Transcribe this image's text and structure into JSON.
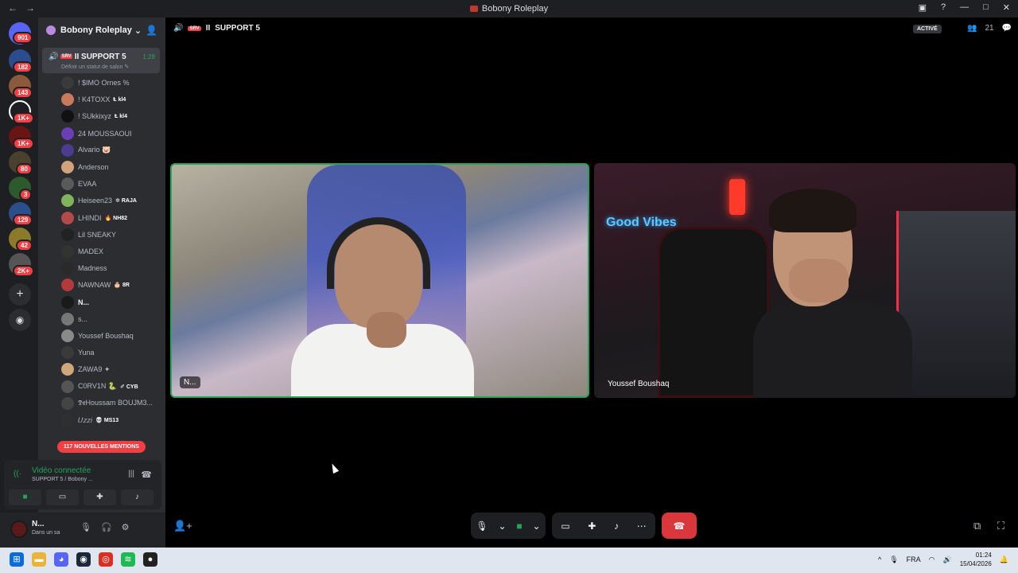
{
  "window": {
    "title": "Bobony Roleplay",
    "back": "←",
    "forward": "→"
  },
  "servers": [
    {
      "badge": "901"
    },
    {
      "badge": "182"
    },
    {
      "badge": "143"
    },
    {
      "badge": "1K+"
    },
    {
      "badge": "1K+"
    },
    {
      "badge": "80"
    },
    {
      "badge": "3"
    },
    {
      "badge": "129"
    },
    {
      "badge": "42"
    },
    {
      "badge": "2K+"
    }
  ],
  "guild": {
    "name": "Bobony Roleplay",
    "caret": "⌄"
  },
  "voice_channel": {
    "name": "SUPPORT 5",
    "prefix": "II",
    "tag": "SRV",
    "timer": "1:28",
    "status_placeholder": "Définir un statut de salon ✎"
  },
  "members": [
    {
      "name": "! $IMO Ornes %",
      "tag": "",
      "color": "#3a3a3a"
    },
    {
      "name": "! K4TOXX",
      "tag": "Ⱡ kl4",
      "color": "#c97a5d"
    },
    {
      "name": "! SUkkixyz",
      "tag": "Ⱡ kl4",
      "color": "#111111"
    },
    {
      "name": "24 MOUSSAOUI",
      "tag": "",
      "color": "#6a3fb4"
    },
    {
      "name": "Alvario 🐷",
      "tag": "",
      "color": "#4b3c8f"
    },
    {
      "name": "Anderson",
      "tag": "",
      "color": "#d1a37a"
    },
    {
      "name": "EVAA",
      "tag": "",
      "color": "#5a5a5a"
    },
    {
      "name": "Heiseen23",
      "tag": "✲ RAJA",
      "color": "#7fb35c"
    },
    {
      "name": "LHINDI",
      "tag": "🔥 NH82",
      "color": "#b34a4a"
    },
    {
      "name": "Lil SNEAKY",
      "tag": "",
      "color": "#222222"
    },
    {
      "name": "MADEX",
      "tag": "",
      "color": "#333333"
    },
    {
      "name": "Madness",
      "tag": "",
      "color": "#2a2a2a"
    },
    {
      "name": "NAWNAW",
      "tag": "🎂 8R",
      "color": "#b33a3a"
    },
    {
      "name": "N...",
      "tag": "",
      "color": "#1a1a1a"
    },
    {
      "name": "s...",
      "tag": "",
      "color": "#777777"
    },
    {
      "name": "Youssef Boushaq",
      "tag": "",
      "color": "#8a8a8a"
    },
    {
      "name": "Yuna",
      "tag": "",
      "color": "#3a3a3a"
    },
    {
      "name": "ZAWA9 ✦",
      "tag": "",
      "color": "#cfa77a"
    },
    {
      "name": "C0RV1N 🐍",
      "tag": "✐ CYB",
      "color": "#555555"
    },
    {
      "name": "𝕯𝖗Houssam BOUJM3...",
      "tag": "",
      "color": "#444444"
    },
    {
      "name": "𝑈𝑧𝑧𝑖",
      "tag": "💀 MS13",
      "color": "#2f2f2f"
    }
  ],
  "mentions": "117 NOUVELLES MENTIONS",
  "voice_panel": {
    "status": "Vidéo connectée",
    "subtitle": "SUPPORT 5 / Bobony ..."
  },
  "user": {
    "name": "N...",
    "status": "Dans un sa"
  },
  "stage": {
    "channel": "SUPPORT 5",
    "prefix": "II",
    "tag": "SRV",
    "activity": "ACTIVÉ",
    "count": "21"
  },
  "tiles": [
    {
      "label": "N..."
    },
    {
      "label": "Youssef Boushaq"
    }
  ],
  "scene_text": {
    "neon_sign": "Good Vibes"
  },
  "tray": {
    "lang": "FRA",
    "time": "01:24",
    "date": "15/04/2026"
  },
  "colors": {
    "accent_green": "#23a559",
    "danger": "#da373c",
    "badge": "#f23f43"
  }
}
